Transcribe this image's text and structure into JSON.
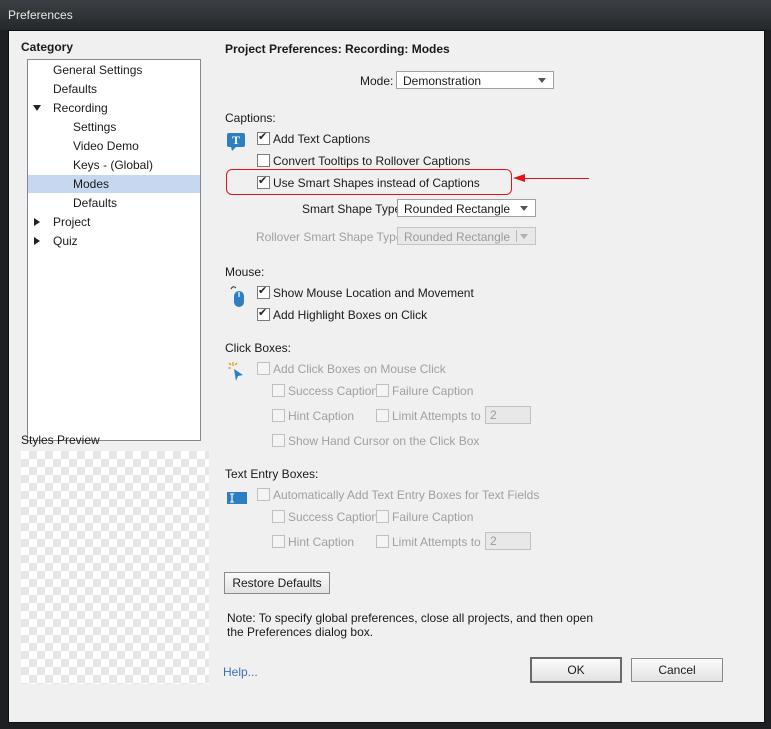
{
  "window": {
    "title": "Preferences"
  },
  "category": {
    "heading": "Category",
    "items": [
      {
        "label": "General Settings"
      },
      {
        "label": "Defaults"
      },
      {
        "label": "Recording"
      },
      {
        "label": "Settings"
      },
      {
        "label": "Video Demo"
      },
      {
        "label": "Keys - (Global)"
      },
      {
        "label": "Modes"
      },
      {
        "label": "Defaults"
      },
      {
        "label": "Project"
      },
      {
        "label": "Quiz"
      }
    ],
    "selected": "Modes"
  },
  "styles_preview": {
    "label": "Styles Preview"
  },
  "panel": {
    "title": "Project Preferences: Recording: Modes",
    "mode_label": "Mode:",
    "mode_value": "Demonstration"
  },
  "captions": {
    "heading": "Captions:",
    "add_text_captions": {
      "label": "Add Text Captions",
      "checked": true
    },
    "convert_tooltips": {
      "label": "Convert Tooltips to Rollover Captions",
      "checked": false
    },
    "use_smart_shapes": {
      "label": "Use Smart Shapes instead of Captions",
      "checked": true
    },
    "smart_shape_type_label": "Smart Shape Type",
    "smart_shape_type_value": "Rounded Rectangle",
    "rollover_shape_type_label": "Rollover Smart Shape Type",
    "rollover_shape_type_value": "Rounded Rectangle"
  },
  "mouse": {
    "heading": "Mouse:",
    "show_location": {
      "label": "Show Mouse Location and Movement",
      "checked": true
    },
    "highlight_boxes": {
      "label": "Add Highlight Boxes on Click",
      "checked": true
    }
  },
  "click_boxes": {
    "heading": "Click Boxes:",
    "add_on_click": {
      "label": "Add Click Boxes on Mouse Click",
      "checked": false
    },
    "success_caption": "Success Caption",
    "failure_caption": "Failure Caption",
    "hint_caption": "Hint Caption",
    "limit_attempts": "Limit Attempts to",
    "limit_value": "2",
    "hand_cursor": "Show Hand Cursor on the Click Box"
  },
  "text_entry": {
    "heading": "Text Entry Boxes:",
    "auto_add": {
      "label": "Automatically Add Text Entry Boxes for Text Fields",
      "checked": false
    },
    "success_caption": "Success Caption",
    "failure_caption": "Failure Caption",
    "hint_caption": "Hint Caption",
    "limit_attempts": "Limit Attempts to",
    "limit_value": "2"
  },
  "buttons": {
    "restore_defaults": "Restore Defaults",
    "ok": "OK",
    "cancel": "Cancel",
    "help": "Help..."
  },
  "note": {
    "line1": "Note: To specify global preferences, close all projects, and then open",
    "line2": "the Preferences dialog box."
  },
  "colors": {
    "annotation": "#e0141c",
    "selection": "#c6d7f0",
    "link": "#3c6fb4"
  }
}
